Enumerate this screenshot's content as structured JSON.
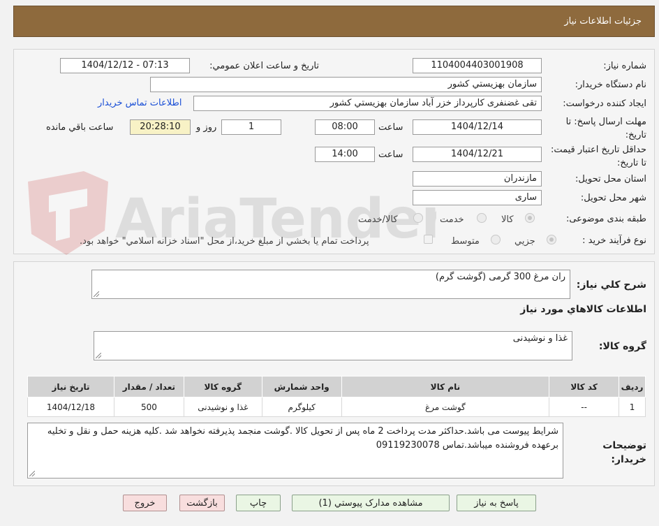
{
  "header": {
    "title": "جزئیات اطلاعات نیاز"
  },
  "labels": {
    "need_number": "شماره نیاز:",
    "announce_datetime": "تاریخ و ساعت اعلان عمومي:",
    "buyer_org": "نام دستگاه خريدار:",
    "requester": "ايجاد کننده درخواست:",
    "reply_deadline": "مهلت ارسال پاسخ: تا تاریخ:",
    "price_validity": "حداقل تاريخ اعتبار قيمت: تا تاريخ:",
    "time": "ساعت",
    "days_and": "روز و",
    "remaining": "ساعت باقي مانده",
    "province": "استان محل تحويل:",
    "city": "شهر محل تحويل:",
    "category": "طبقه بندی موضوعی:",
    "purchase_type": "نوع فرآيند خريد :",
    "general_desc": "شرح کلي نياز:",
    "goods_info": "اطلاعات کالاهاي مورد نياز",
    "goods_group": "گروه کالا:",
    "buyer_notes": "توضيحات خريدار:"
  },
  "fields": {
    "need_number": "1104004403001908",
    "announce_datetime": "1404/12/12 - 07:13",
    "buyer_org": "سازمان بهزيستي کشور",
    "requester": "تقی غضنفری کارپرداز خزر آباد سازمان بهزيستي کشور",
    "contact_link": "اطلاعات تماس خريدار",
    "reply_date": "1404/12/14",
    "reply_time": "08:00",
    "days_remaining": "1",
    "time_remaining": "20:28:10",
    "validity_date": "1404/12/21",
    "validity_time": "14:00",
    "province": "مازندران",
    "city": "ساری",
    "general_desc": "ران مرغ 300 گرمی (گوشت گرم)",
    "goods_group": "غذا و نوشیدنی",
    "buyer_notes": "شرایط پیوست می باشد.حداکثر مدت پرداخت 2 ماه پس از تحویل کالا .گوشت منجمد پذیرفته نخواهد شد .کلیه هزینه حمل و نقل و تخلیه برعهده فروشنده میباشد.تماس 09119230078"
  },
  "category_options": [
    "کالا",
    "خدمت",
    "کالا/خدمت"
  ],
  "purchase_options": [
    "جزيي",
    "متوسط"
  ],
  "purchase_note": "پرداخت تمام يا بخشي از مبلغ خريد،از محل \"اسناد خزانه اسلامي\" خواهد بود.",
  "table": {
    "headers": [
      "رديف",
      "کد کالا",
      "نام کالا",
      "واحد شمارش",
      "گروه کالا",
      "تعداد / مقدار",
      "تاريخ نياز"
    ],
    "rows": [
      [
        "1",
        "--",
        "گوشت مرغ",
        "کیلوگرم",
        "غذا و نوشیدنی",
        "500",
        "1404/12/18"
      ]
    ]
  },
  "buttons": {
    "reply": "پاسخ به نياز",
    "attachments": "مشاهده مدارک پيوستي (1)",
    "print": "چاپ",
    "back": "بازگشت",
    "exit": "خروج"
  },
  "watermark": "AriaTender.net",
  "colors": {
    "header": "#8e6a3d",
    "link": "#1a4fd6",
    "button_green": "#eaf6e4",
    "button_red": "#f8dede"
  }
}
